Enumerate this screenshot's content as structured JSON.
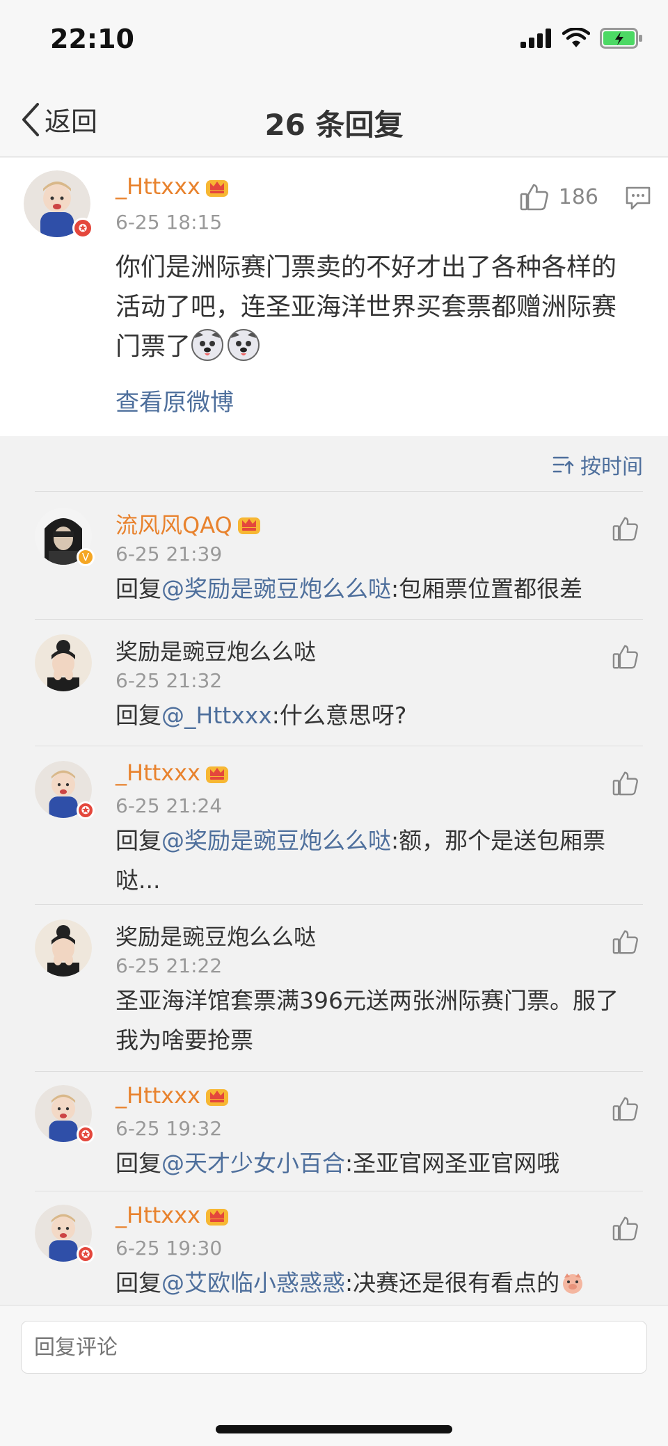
{
  "status": {
    "time": "22:10"
  },
  "nav": {
    "back_label": "返回",
    "title": "26 条回复"
  },
  "main_comment": {
    "username": "_Httxxx",
    "time": "6-25 18:15",
    "likes": "186",
    "text": "你们是洲际赛门票卖的不好才出了各种各样的活动了吧，连圣亚海洋世界买套票都赠洲际赛门票了",
    "view_original": "查看原微博"
  },
  "sort": {
    "label": "按时间"
  },
  "replies": [
    {
      "username": "流风风QAQ",
      "time": "6-25 21:39",
      "prefix": "回复",
      "mention": "@奖励是豌豆炮么么哒",
      "text": ":包厢票位置都很差"
    },
    {
      "username": "奖励是豌豆炮么么哒",
      "time": "6-25 21:32",
      "prefix": "回复",
      "mention": "@_Httxxx",
      "text": ":什么意思呀?"
    },
    {
      "username": "_Httxxx",
      "time": "6-25 21:24",
      "prefix": "回复",
      "mention": "@奖励是豌豆炮么么哒",
      "text": ":额，那个是送包厢票哒..."
    },
    {
      "username": "奖励是豌豆炮么么哒",
      "time": "6-25 21:22",
      "prefix": "",
      "mention": "",
      "text": "圣亚海洋馆套票满396元送两张洲际赛门票。服了 我为啥要抢票"
    },
    {
      "username": "_Httxxx",
      "time": "6-25 19:32",
      "prefix": "回复",
      "mention": "@天才少女小百合",
      "text": ":圣亚官网圣亚官网哦"
    },
    {
      "username": "_Httxxx",
      "time": "6-25 19:30",
      "prefix": "回复",
      "mention": "@艾欧临小惑惑惑",
      "text": ":决赛还是很有看点的"
    }
  ],
  "reply_box": {
    "placeholder": "回复评论"
  },
  "colors": {
    "username_vip": "#e8822d",
    "mention": "#4e6f9c",
    "time": "#999999"
  }
}
